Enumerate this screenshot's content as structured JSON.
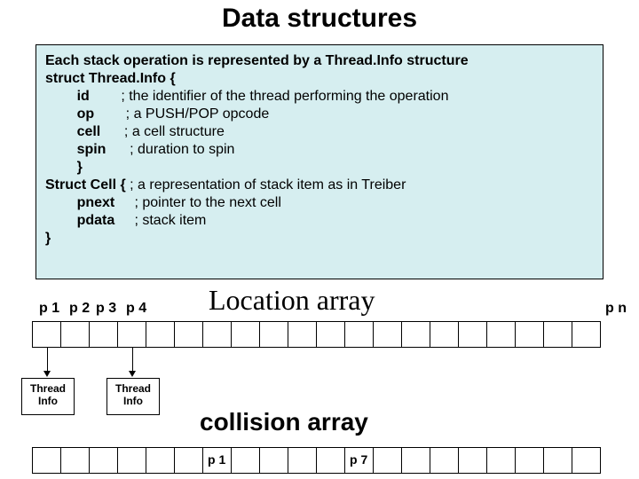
{
  "title": "Data structures",
  "code": {
    "l1": "Each stack operation is represented by a Thread.Info structure",
    "l2": "struct Thread.Info {",
    "l3a": "        id",
    "l3b": "        ; the identifier of the thread performing the operation",
    "l4a": "        op",
    "l4b": "        ; a PUSH/POP opcode",
    "l5a": "        cell",
    "l5b": "      ; a cell structure",
    "l6a": "        spin",
    "l6b": "      ; duration to spin",
    "l7": "        }",
    "l8a": "Struct Cell {",
    "l8b": " ; a representation of stack item as in Treiber",
    "l9a": "        pnext",
    "l9b": "     ; pointer to the next cell",
    "l10a": "        pdata",
    "l10b": "     ; stack item",
    "l11": "}"
  },
  "location_array_title": "Location array",
  "collision_array_title": "collision array",
  "p_labels": {
    "p1": "p 1",
    "p2": "p 2",
    "p3": "p 3",
    "p4": "p 4",
    "pn": "p n"
  },
  "thread_info_label": "Thread Info",
  "coll_cells": {
    "c1": "p 1",
    "c7": "p 7"
  },
  "colors": {
    "box_bg": "#d6eef0"
  }
}
